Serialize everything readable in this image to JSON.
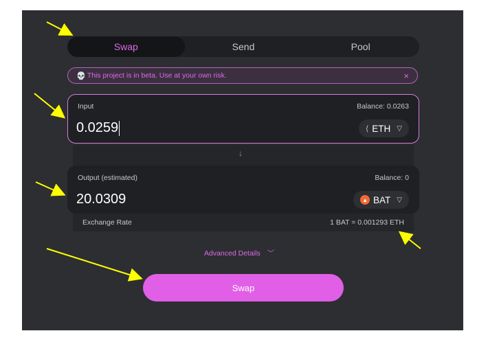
{
  "tabs": [
    {
      "label": "Swap",
      "active": true
    },
    {
      "label": "Send",
      "active": false
    },
    {
      "label": "Pool",
      "active": false
    }
  ],
  "beta_banner": {
    "icon": "skull-icon",
    "text": "This project is in beta. Use at your own risk.",
    "close": "×"
  },
  "input_card": {
    "label": "Input",
    "balance": "Balance: 0.0263",
    "value": "0.0259",
    "token": {
      "icon": "eth-icon",
      "symbol": "ETH"
    }
  },
  "output_card": {
    "label": "Output (estimated)",
    "balance": "Balance: 0",
    "value": "20.0309",
    "token": {
      "icon": "bat-icon",
      "symbol": "BAT"
    }
  },
  "exchange_rate": {
    "label": "Exchange Rate",
    "value": "1 BAT = 0.001293 ETH"
  },
  "advanced": {
    "label": "Advanced Details"
  },
  "swap_button": {
    "label": "Swap"
  },
  "colors": {
    "accent": "#dc6be5",
    "panel": "#2d2e32",
    "annotation": "#ffff00"
  }
}
